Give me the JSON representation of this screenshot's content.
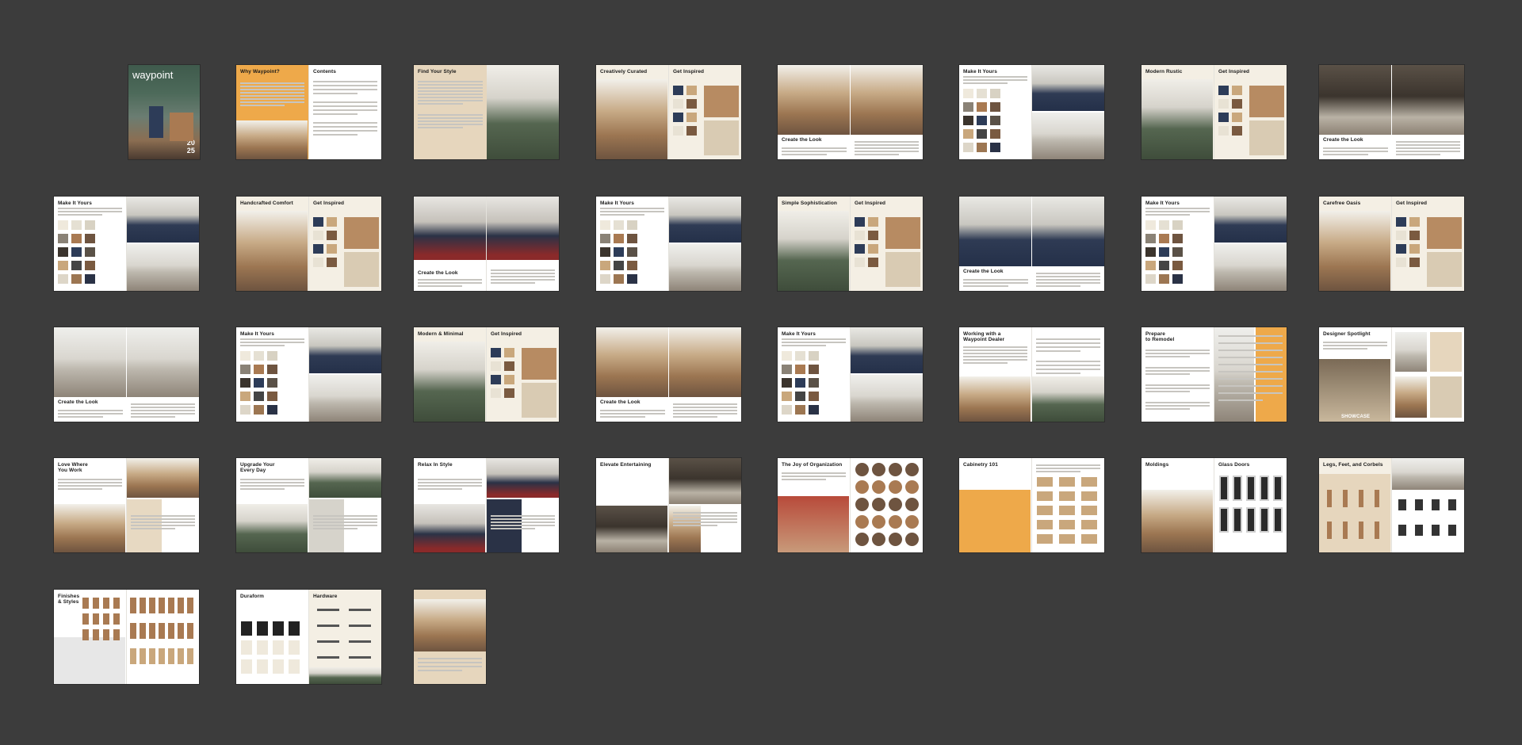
{
  "viewer": {
    "background": "#3c3c3c",
    "layout": "spreads-grid"
  },
  "cover": {
    "brand": "waypoint",
    "year": "20\n25"
  },
  "spreads": [
    {
      "id": "s1",
      "left_title": "Why Waypoint?",
      "right_title": "Contents"
    },
    {
      "id": "s2",
      "left_title": "Find Your Style",
      "right_title": ""
    },
    {
      "id": "s3",
      "left_title": "Creatively Curated",
      "right_title": "Get Inspired"
    },
    {
      "id": "s4",
      "left_title": "Create the Look",
      "right_title": ""
    },
    {
      "id": "s5",
      "left_title": "Make It Yours",
      "right_title": ""
    },
    {
      "id": "s6",
      "left_title": "Modern Rustic",
      "right_title": "Get Inspired"
    },
    {
      "id": "s7",
      "left_title": "Create the Look",
      "right_title": ""
    },
    {
      "id": "s8",
      "left_title": "Make It Yours",
      "right_title": ""
    },
    {
      "id": "s9",
      "left_title": "Handcrafted Comfort",
      "right_title": "Get Inspired"
    },
    {
      "id": "s10",
      "left_title": "Create the Look",
      "right_title": ""
    },
    {
      "id": "s11",
      "left_title": "Make It Yours",
      "right_title": ""
    },
    {
      "id": "s12",
      "left_title": "Simple Sophistication",
      "right_title": "Get Inspired"
    },
    {
      "id": "s13",
      "left_title": "Create the Look",
      "right_title": ""
    },
    {
      "id": "s14",
      "left_title": "Make It Yours",
      "right_title": ""
    },
    {
      "id": "s15",
      "left_title": "Carefree Oasis",
      "right_title": "Get Inspired"
    },
    {
      "id": "s16",
      "left_title": "Create the Look",
      "right_title": ""
    },
    {
      "id": "s17",
      "left_title": "Make It Yours",
      "right_title": ""
    },
    {
      "id": "s18",
      "left_title": "Modern & Minimal",
      "right_title": "Get Inspired"
    },
    {
      "id": "s19",
      "left_title": "Create the Look",
      "right_title": ""
    },
    {
      "id": "s20",
      "left_title": "Make It Yours",
      "right_title": ""
    },
    {
      "id": "s21",
      "left_title": "Working with a\nWaypoint Dealer",
      "right_title": ""
    },
    {
      "id": "s22",
      "left_title": "Prepare\nto Remodel",
      "right_title": ""
    },
    {
      "id": "s23",
      "left_title": "Designer Spotlight",
      "right_title": "",
      "feature": "SHOWCASE"
    },
    {
      "id": "s24",
      "left_title": "Love Where\nYou Work",
      "right_title": ""
    },
    {
      "id": "s25",
      "left_title": "Upgrade Your\nEvery Day",
      "right_title": ""
    },
    {
      "id": "s26",
      "left_title": "Relax In Style",
      "right_title": ""
    },
    {
      "id": "s27",
      "left_title": "Elevate Entertaining",
      "right_title": ""
    },
    {
      "id": "s28",
      "left_title": "The Joy of Organization",
      "right_title": ""
    },
    {
      "id": "s29",
      "left_title": "Cabinetry 101",
      "right_title": ""
    },
    {
      "id": "s30",
      "left_title": "Moldings",
      "right_title": "Glass Doors"
    },
    {
      "id": "s31",
      "left_title": "Legs, Feet, and Corbels",
      "right_title": ""
    },
    {
      "id": "s32",
      "left_title": "Finishes\n& Styles",
      "right_title": ""
    },
    {
      "id": "s33",
      "left_title": "Duraform",
      "right_title": "Hardware"
    }
  ],
  "back_cover": {
    "label": ""
  },
  "colors": {
    "accent_orange": "#eea94a",
    "tan": "#e6d6bd",
    "navy": "#2d3c58",
    "sage": "#5a6c52",
    "cream": "#f4efe4",
    "wood": "#a97a52"
  }
}
